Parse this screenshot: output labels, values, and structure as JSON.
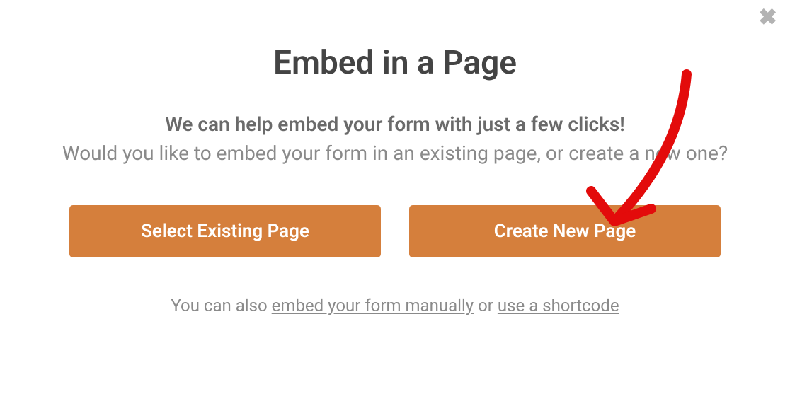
{
  "modal": {
    "title": "Embed in a Page",
    "subtitle_bold": "We can help embed your form with just a few clicks!",
    "subtitle_regular": "Would you like to embed your form in an existing page, or create a new one?",
    "select_existing_label": "Select Existing Page",
    "create_new_label": "Create New Page",
    "footer_prefix": "You can also ",
    "footer_link1": "embed your form manually",
    "footer_mid": " or ",
    "footer_link2": "use a shortcode"
  }
}
